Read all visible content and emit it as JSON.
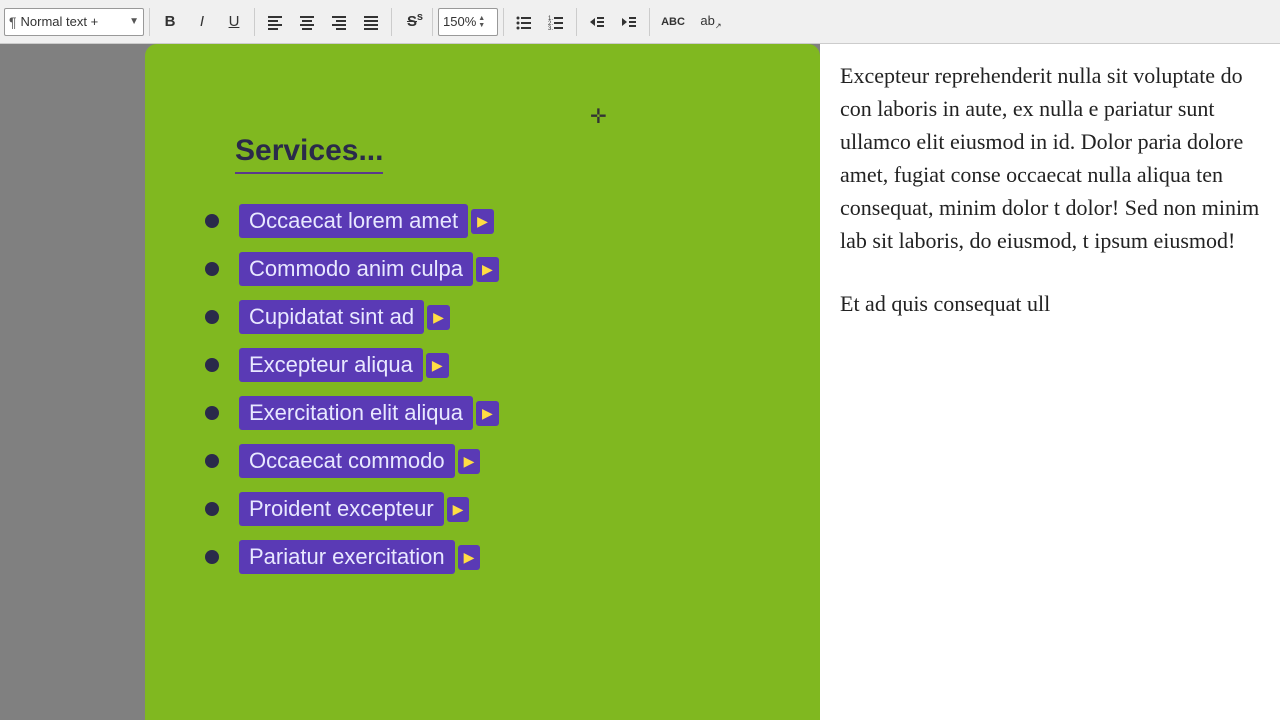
{
  "toolbar": {
    "style_label": "Normal text +",
    "bold_label": "B",
    "italic_label": "I",
    "underline_label": "U",
    "zoom_value": "150%",
    "buttons": [
      "align-left",
      "align-center",
      "align-right",
      "justify",
      "strikethrough",
      "list-unordered",
      "list-ordered",
      "outdent",
      "indent",
      "spellcheck",
      "autocorrect"
    ]
  },
  "doc": {
    "heading": "Services...",
    "items": [
      {
        "label": "Occaecat lorem amet",
        "has_arrow": true
      },
      {
        "label": "Commodo anim culpa",
        "has_arrow": true
      },
      {
        "label": "Cupidatat sint ad",
        "has_arrow": true
      },
      {
        "label": "Excepteur aliqua",
        "has_arrow": true
      },
      {
        "label": "Exercitation elit aliqua",
        "has_arrow": true
      },
      {
        "label": "Occaecat commodo",
        "has_arrow": true
      },
      {
        "label": "Proident excepteur",
        "has_arrow": true
      },
      {
        "label": "Pariatur exercitation",
        "has_arrow": true
      }
    ]
  },
  "right_text": {
    "paragraph1": "Excepteur reprehenderit nulla sit voluptate do con laboris in aute, ex nulla e pariatur sunt ullamco elit eiusmod in id. Dolor paria dolore amet, fugiat conse occaecat nulla aliqua ten consequat, minim dolor t dolor! Sed non minim lab sit laboris, do eiusmod, t ipsum eiusmod!",
    "paragraph2": "Et ad quis consequat ull"
  },
  "colors": {
    "green_bg": "#80b820",
    "purple_link": "#5a3ab5",
    "dark_heading": "#2a2a4a"
  }
}
